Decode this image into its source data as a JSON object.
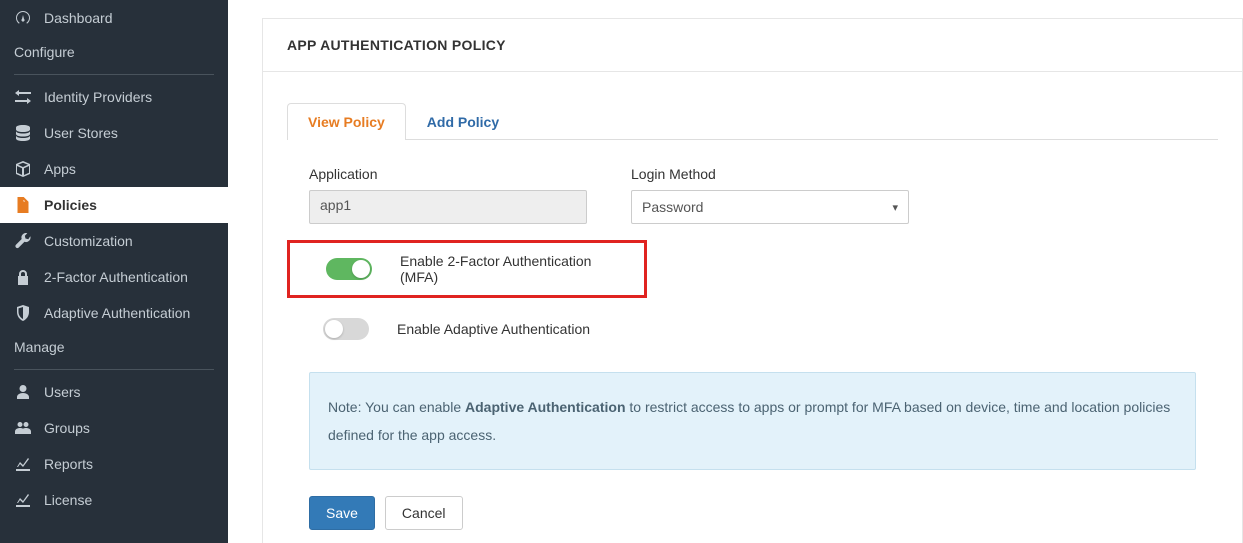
{
  "sidebar": {
    "items": [
      {
        "label": "Dashboard",
        "icon": "dashboard-icon"
      }
    ],
    "sections": [
      {
        "label": "Configure",
        "items": [
          {
            "label": "Identity Providers",
            "icon": "arrows-icon"
          },
          {
            "label": "User Stores",
            "icon": "stack-icon"
          },
          {
            "label": "Apps",
            "icon": "box-icon"
          },
          {
            "label": "Policies",
            "icon": "file-icon",
            "active": true
          },
          {
            "label": "Customization",
            "icon": "wrench-icon"
          },
          {
            "label": "2-Factor Authentication",
            "icon": "lock-icon"
          },
          {
            "label": "Adaptive Authentication",
            "icon": "shield-icon"
          }
        ]
      },
      {
        "label": "Manage",
        "items": [
          {
            "label": "Users",
            "icon": "user-icon"
          },
          {
            "label": "Groups",
            "icon": "users-icon"
          },
          {
            "label": "Reports",
            "icon": "chart-icon"
          },
          {
            "label": "License",
            "icon": "chart-icon"
          }
        ]
      }
    ]
  },
  "panel": {
    "title": "APP AUTHENTICATION POLICY"
  },
  "tabs": {
    "view": "View Policy",
    "add": "Add Policy"
  },
  "form": {
    "app_label": "Application",
    "app_value": "app1",
    "login_label": "Login Method",
    "login_value": "Password"
  },
  "toggles": {
    "mfa_label": "Enable 2-Factor Authentication (MFA)",
    "mfa_on": true,
    "adaptive_label": "Enable Adaptive Authentication",
    "adaptive_on": false
  },
  "note": {
    "prefix": "Note: You can enable ",
    "bold": "Adaptive Authentication",
    "suffix": " to restrict access to apps or prompt for MFA based on device, time and location policies defined for the app access."
  },
  "buttons": {
    "save": "Save",
    "cancel": "Cancel"
  }
}
